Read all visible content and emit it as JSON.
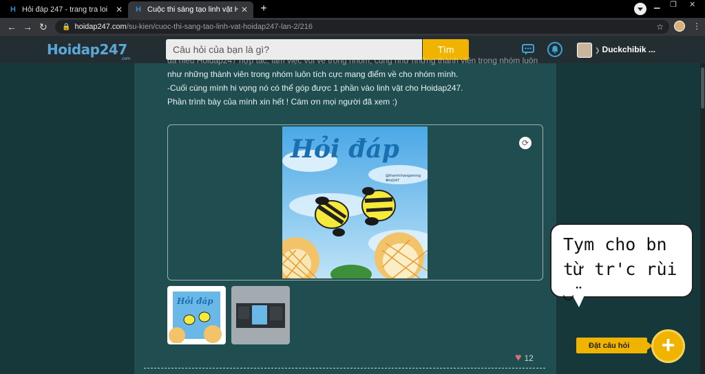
{
  "browser": {
    "tabs": [
      {
        "title": "Hỏi đáp 247 - trang tra loi",
        "active": false
      },
      {
        "title": "Cuộc thi sáng tạo linh vật Hoidap",
        "active": true
      }
    ],
    "url_host": "hoidap247.com",
    "url_path": "/su-kien/cuoc-thi-sang-tao-linh-vat-hoidap247-lan-2/216"
  },
  "header": {
    "logo_main": "Hoidap247",
    "logo_sub": ".com",
    "search_placeholder": "Câu hỏi của bạn là gì?",
    "search_button": "Tìm",
    "username": "Duckchibik ..."
  },
  "post": {
    "paragraph_cut": "đã hiểu Hoidap247 hợp tác, làm việc vui vẻ trong nhóm, cũng như những thành viên trong nhóm luôn",
    "lines": [
      "như những thành viên trong nhóm luôn tích cực mang điểm về cho nhóm mình.",
      "-Cuối cùng mình hi vọng nó có thể góp được 1 phần vào linh vật cho Hoidap247.",
      "Phần trình bày của mình xin hết ! Cám ơn mọi người đã xem :)"
    ],
    "image_title": "Hỏi đáp",
    "image_credit": "@thanhnhangaming",
    "image_tag": "#hd247",
    "thumb_title": "Hỏi đáp",
    "like_count": "12"
  },
  "overlay": {
    "bubble_text": "Tym cho bn\ntừ tr'c rùi ◡̈",
    "ask_button": "Đặt câu hỏi",
    "plus": "+"
  },
  "colors": {
    "brand_yellow": "#f0b400",
    "brand_blue": "#3ea6d6",
    "content_bg": "#1f4d50"
  }
}
